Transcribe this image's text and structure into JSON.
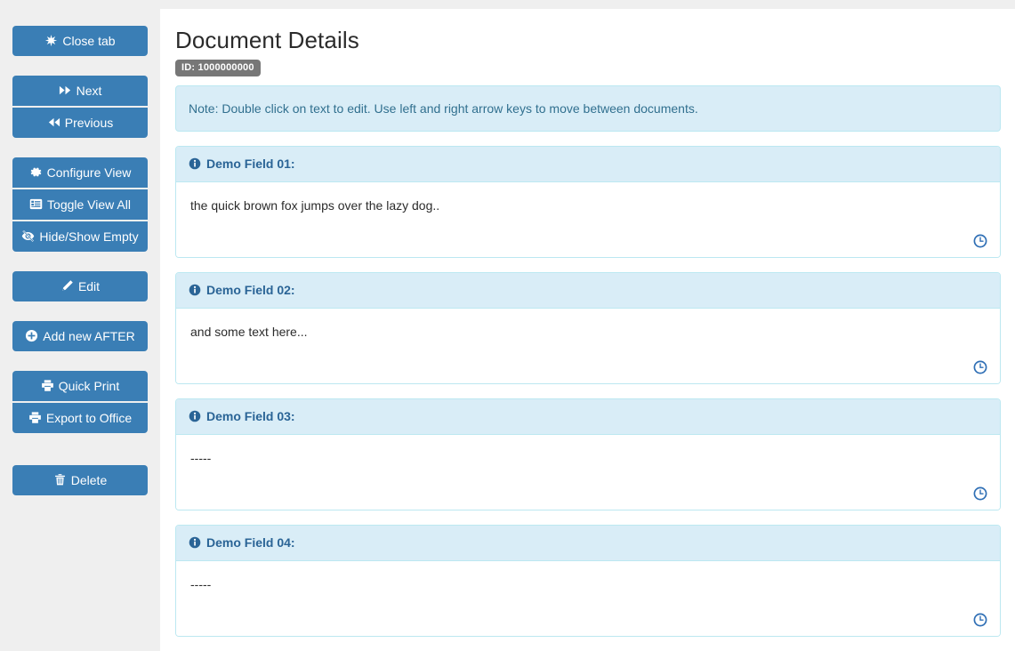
{
  "sidebar": {
    "groups": [
      {
        "items": [
          {
            "label": "Close tab",
            "icon": "asterisk-icon",
            "name": "close-tab"
          }
        ]
      },
      {
        "items": [
          {
            "label": "Next",
            "icon": "forward-icon",
            "name": "next"
          },
          {
            "label": "Previous",
            "icon": "backward-icon",
            "name": "previous"
          }
        ]
      },
      {
        "items": [
          {
            "label": "Configure View",
            "icon": "gear-icon",
            "name": "configure-view"
          },
          {
            "label": "Toggle View All",
            "icon": "list-alt-icon",
            "name": "toggle-view-all"
          },
          {
            "label": "Hide/Show Empty",
            "icon": "eye-slash-icon",
            "name": "hide-show-empty"
          }
        ]
      },
      {
        "items": [
          {
            "label": "Edit",
            "icon": "pencil-icon",
            "name": "edit"
          }
        ]
      },
      {
        "items": [
          {
            "label": "Add new AFTER",
            "icon": "plus-circle-icon",
            "name": "add-new-after"
          }
        ]
      },
      {
        "items": [
          {
            "label": "Quick Print",
            "icon": "print-icon",
            "name": "quick-print"
          },
          {
            "label": "Export to Office",
            "icon": "print-icon",
            "name": "export-to-office"
          }
        ]
      },
      {
        "items": [
          {
            "label": "Delete",
            "icon": "trash-icon",
            "name": "delete"
          }
        ]
      }
    ]
  },
  "main": {
    "title": "Document Details",
    "id_badge": "ID: 1000000000",
    "note": "Note: Double click on text to edit. Use left and right arrow keys to move between documents.",
    "fields": [
      {
        "label": "Demo Field 01:",
        "value": "the quick brown fox jumps over the lazy dog..",
        "history_icon": "clock-icon"
      },
      {
        "label": "Demo Field 02:",
        "value": "and some text here...",
        "history_icon": "clock-icon"
      },
      {
        "label": "Demo Field 03:",
        "value": "-----",
        "history_icon": "clock-icon"
      },
      {
        "label": "Demo Field 04:",
        "value": "-----",
        "history_icon": "clock-icon"
      }
    ]
  },
  "colors": {
    "button_blue": "#3a7eb5",
    "panel_header_blue": "#d9edf7",
    "panel_border_blue": "#bce8f1",
    "alert_text_blue": "#31708f",
    "badge_gray": "#777777",
    "sidebar_gray": "#efefef"
  }
}
